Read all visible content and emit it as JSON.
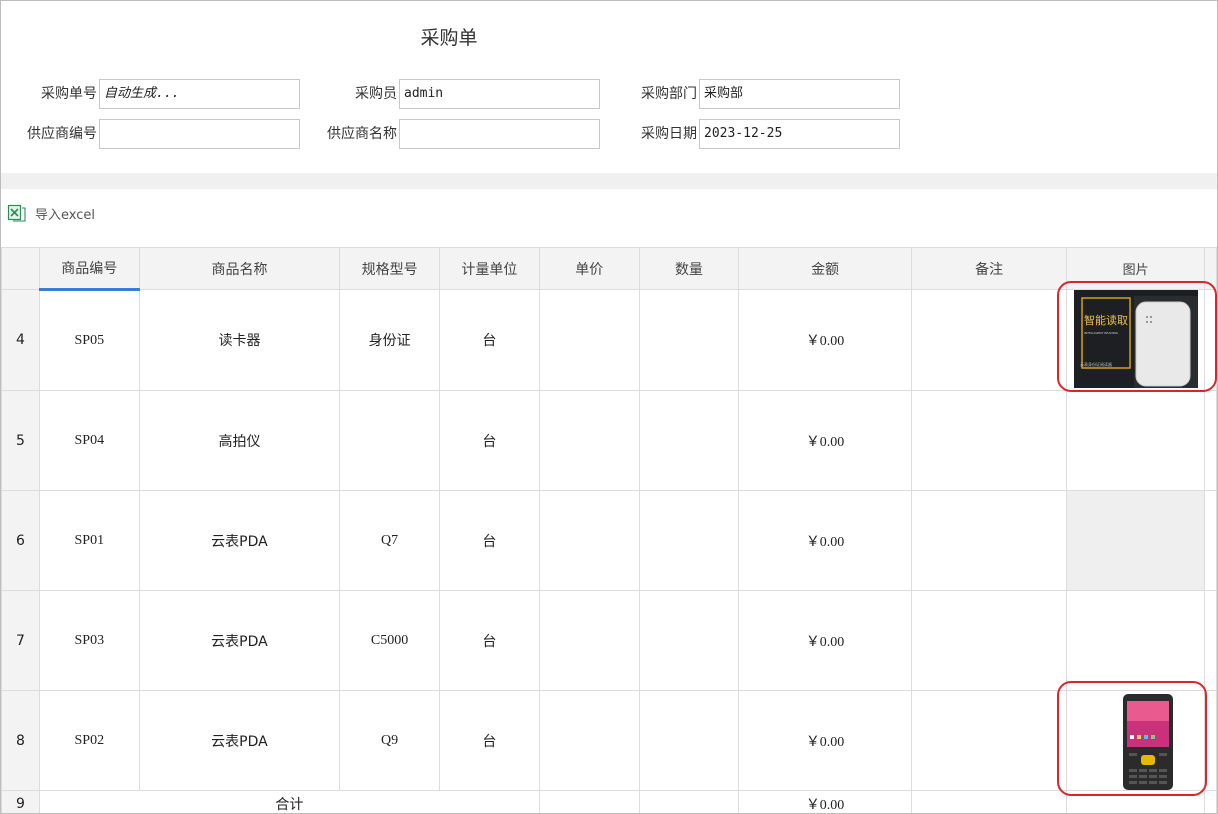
{
  "form": {
    "title": "采购单",
    "fields": {
      "order_no_label": "采购单号",
      "order_no_value": "自动生成...",
      "buyer_label": "采购员",
      "buyer_value": "admin",
      "dept_label": "采购部门",
      "dept_value": "采购部",
      "supplier_no_label": "供应商编号",
      "supplier_no_value": "",
      "supplier_name_label": "供应商名称",
      "supplier_name_value": "",
      "date_label": "采购日期",
      "date_value": "2023-12-25"
    }
  },
  "toolbar": {
    "import_label": "导入excel"
  },
  "table": {
    "headers": [
      "商品编号",
      "商品名称",
      "规格型号",
      "计量单位",
      "单价",
      "数量",
      "金额",
      "备注",
      "图片"
    ],
    "rows": [
      {
        "num": "4",
        "code": "SP05",
        "name": "读卡器",
        "spec": "身份证",
        "unit": "台",
        "price": "",
        "qty": "",
        "amount": "￥0.00",
        "note": ""
      },
      {
        "num": "5",
        "code": "SP04",
        "name": "高拍仪",
        "spec": "",
        "unit": "台",
        "price": "",
        "qty": "",
        "amount": "￥0.00",
        "note": ""
      },
      {
        "num": "6",
        "code": "SP01",
        "name": "云表PDA",
        "spec": "Q7",
        "unit": "台",
        "price": "",
        "qty": "",
        "amount": "￥0.00",
        "note": ""
      },
      {
        "num": "7",
        "code": "SP03",
        "name": "云表PDA",
        "spec": "C5000",
        "unit": "台",
        "price": "",
        "qty": "",
        "amount": "￥0.00",
        "note": ""
      },
      {
        "num": "8",
        "code": "SP02",
        "name": "云表PDA",
        "spec": "Q9",
        "unit": "台",
        "price": "",
        "qty": "",
        "amount": "￥0.00",
        "note": ""
      }
    ],
    "summary": {
      "num": "9",
      "label": "合计",
      "amount": "￥0.00"
    }
  },
  "product_image_1": {
    "line1": "智能读取",
    "line2": "INTELLIGENT READING",
    "line3": "云表身份证阅读器"
  }
}
